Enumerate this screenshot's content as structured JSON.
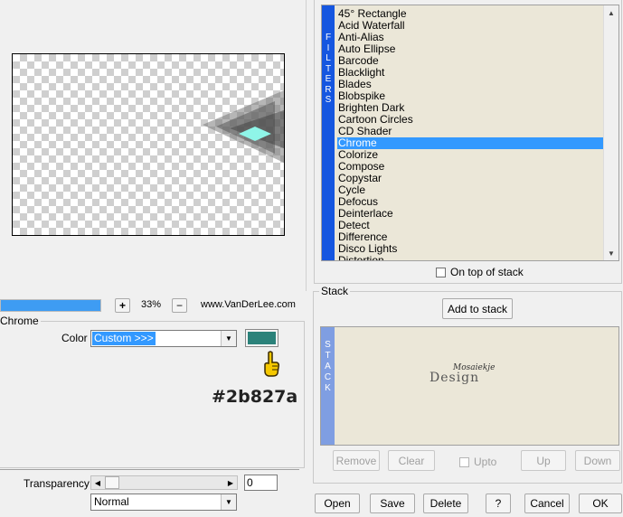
{
  "filters": {
    "group_label": "Filters",
    "vertical_label": [
      "F",
      "I",
      "L",
      "T",
      "E",
      "R",
      "S"
    ],
    "items": [
      "45° Rectangle",
      "Acid Waterfall",
      "Anti-Alias",
      "Auto Ellipse",
      "Barcode",
      "Blacklight",
      "Blades",
      "Blobspike",
      "Brighten Dark",
      "Cartoon Circles",
      "CD Shader",
      "Chrome",
      "Colorize",
      "Compose",
      "Copystar",
      "Cycle",
      "Defocus",
      "Deinterlace",
      "Detect",
      "Difference",
      "Disco Lights",
      "Distortion"
    ],
    "selected": "Chrome",
    "on_top_label": "On top of stack"
  },
  "zoom": {
    "plus": "+",
    "value": "33%",
    "minus": "−",
    "brand": "www.VanDerLee.com",
    "progress": 1.0
  },
  "settings": {
    "group_label": "Chrome",
    "color_label": "Color",
    "color_value": "Custom >>>",
    "swatch_color": "#2b827a",
    "hex_text": "#2b827a",
    "transparency_label": "Transparency",
    "transparency_value": "0",
    "blend_value": "Normal"
  },
  "stack": {
    "group_label": "Stack",
    "add_label": "Add to stack",
    "vertical_label": [
      "S",
      "T",
      "A",
      "C",
      "K"
    ],
    "watermark_1": "Mosaiekje",
    "watermark_2": "Design",
    "remove_label": "Remove",
    "clear_label": "Clear",
    "upto_label": "Upto",
    "up_label": "Up",
    "down_label": "Down"
  },
  "bottom": {
    "open": "Open",
    "save": "Save",
    "delete": "Delete",
    "help": "?",
    "cancel": "Cancel",
    "ok": "OK"
  }
}
